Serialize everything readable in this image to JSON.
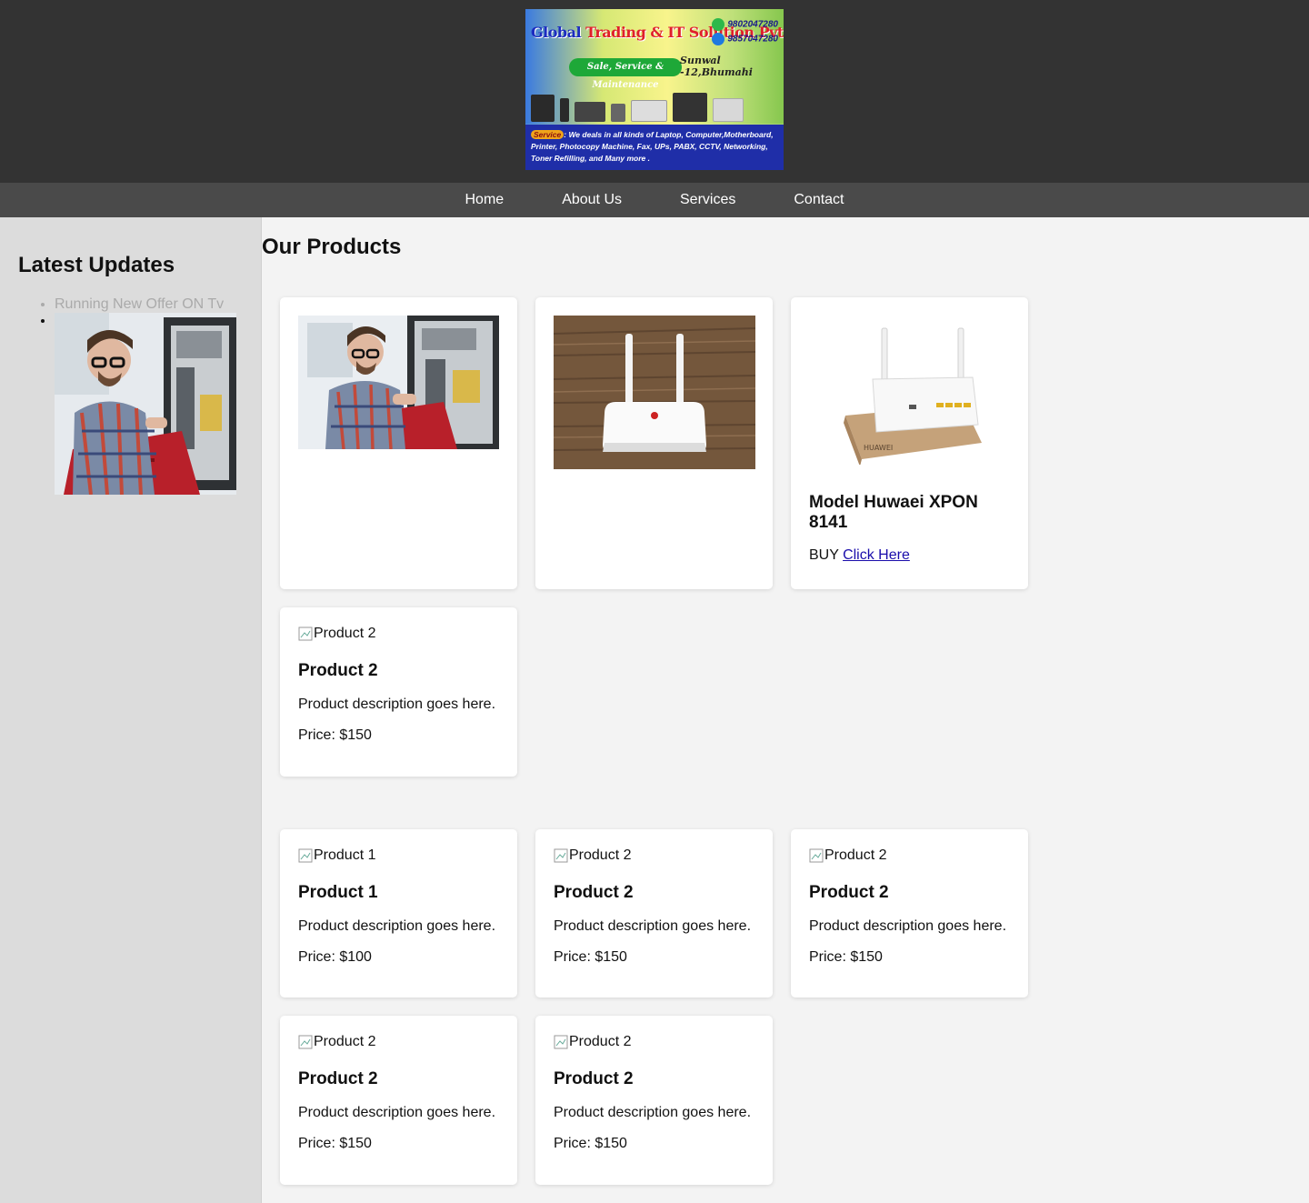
{
  "header": {
    "banner": {
      "title_a": "Global ",
      "title_b": "Trading & IT Solution Pvt.Ltd.",
      "phone1": "9802047280",
      "phone2": "9857047280",
      "pill": "Sale, Service & Maintenance",
      "location": "Sunwal -12,Bhumahi",
      "service_tag": "Service",
      "service_text": ": We deals in all kinds of  Laptop, Computer,Motherboard, Printer, Photocopy Machine, Fax, UPs, PABX, CCTV, Networking, Toner Refilling, and Many more ."
    }
  },
  "nav": [
    "Home",
    "About Us",
    "Services",
    "Contact"
  ],
  "sidebar": {
    "title": "Latest Updates",
    "items": [
      "Running New Offer ON Tv"
    ]
  },
  "main": {
    "title": "Our Products",
    "featured": {
      "card3": {
        "title": "Model Huwaei XPON 8141",
        "buy_label": "BUY ",
        "link_label": "Click Here"
      },
      "card4": {
        "img_alt": "Product 2",
        "title": "Product 2",
        "desc": "Product description goes here.",
        "price": "Price: $150"
      }
    },
    "products": [
      {
        "img_alt": "Product 1",
        "title": "Product 1",
        "desc": "Product description goes here.",
        "price": "Price: $100"
      },
      {
        "img_alt": "Product 2",
        "title": "Product 2",
        "desc": "Product description goes here.",
        "price": "Price: $150"
      },
      {
        "img_alt": "Product 2",
        "title": "Product 2",
        "desc": "Product description goes here.",
        "price": "Price: $150"
      },
      {
        "img_alt": "Product 2",
        "title": "Product 2",
        "desc": "Product description goes here.",
        "price": "Price: $150"
      },
      {
        "img_alt": "Product 2",
        "title": "Product 2",
        "desc": "Product description goes here.",
        "price": "Price: $150"
      }
    ]
  },
  "colors": {
    "header_bg": "#333333",
    "nav_bg": "#4a4a4a",
    "sidebar_bg": "#dcdcdc",
    "page_bg": "#f3f3f3",
    "link": "#1a0dab"
  }
}
